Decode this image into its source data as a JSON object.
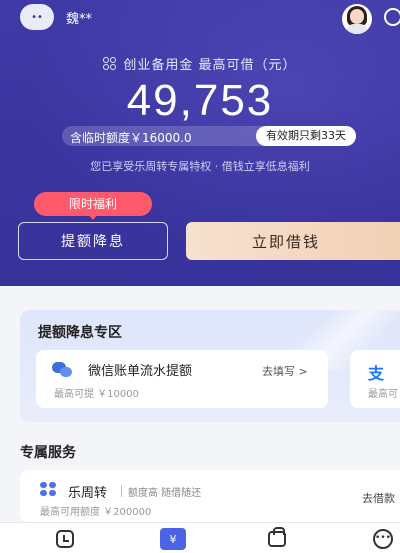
{
  "header": {
    "user_name": "魏**",
    "avatar_text": "••"
  },
  "quota": {
    "title": "创业备用金 最高可借（元）",
    "amount": "49,753",
    "temporary": "含临时额度￥16000.0",
    "validity": "有效期只剩33天",
    "privilege": "您已享受乐周转专属特权 · 借钱立享低息福利"
  },
  "actions": {
    "badge": "限时福利",
    "raise_label": "提额降息",
    "borrow_label": "立即借钱"
  },
  "promo": {
    "title": "提额降息专区",
    "card1": {
      "title": "微信账单流水提额",
      "sub": "最高可提 ￥10000",
      "link": "去填写 >"
    },
    "card2": {
      "icon": "支",
      "sub": "最高可"
    }
  },
  "services": {
    "title": "专属服务",
    "item": {
      "name": "乐周转",
      "tag": "额度高 随借随还",
      "sub": "最高可用额度 ￥200000",
      "link": "去借款"
    }
  },
  "tabbar": {
    "loan_glyph": "¥"
  },
  "colors": {
    "hero": "#3b35a0",
    "badge": "#ff5a6c",
    "borrow_button": "#f2cfb3",
    "accent": "#4d63e6"
  },
  "icons": [
    "user-avatar",
    "agent-avatar",
    "message-icon",
    "quota-logo-icon",
    "wechat-icon",
    "alipay-icon",
    "service-logo-icon",
    "home-tab-icon",
    "loan-tab-icon",
    "bag-tab-icon",
    "more-tab-icon"
  ]
}
